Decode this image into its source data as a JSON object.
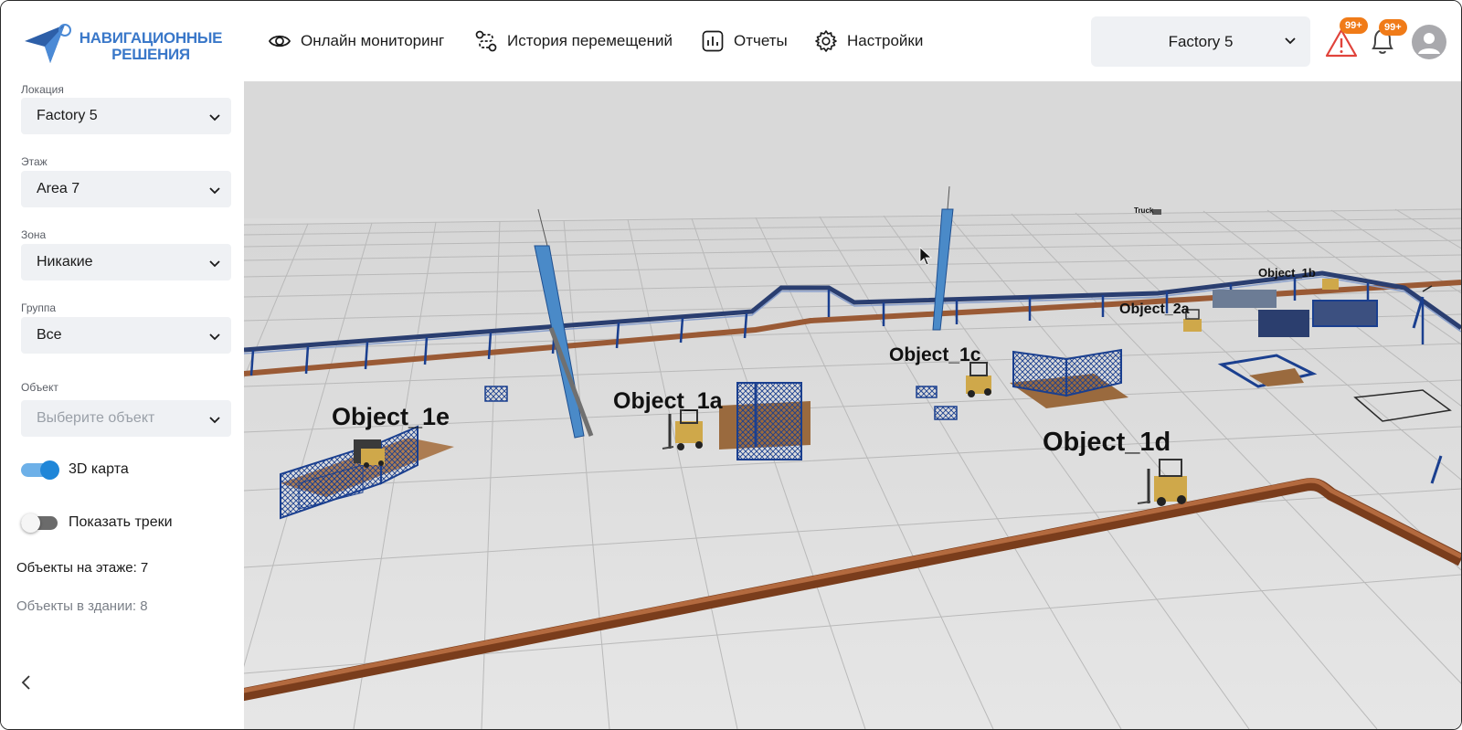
{
  "logo": {
    "line1": "НАВИГАЦИОННЫЕ",
    "line2": "РЕШЕНИЯ"
  },
  "nav": {
    "monitoring": "Онлайн мониторинг",
    "history": "История перемещений",
    "reports": "Отчеты",
    "settings": "Настройки"
  },
  "header": {
    "location_value": "Factory 5",
    "alerts_badge": "99+",
    "notifications_badge": "99+"
  },
  "sidebar": {
    "location": {
      "label": "Локация",
      "value": "Factory 5"
    },
    "floor": {
      "label": "Этаж",
      "value": "Area 7"
    },
    "zone": {
      "label": "Зона",
      "value": "Никакие"
    },
    "group": {
      "label": "Группа",
      "value": "Все"
    },
    "object": {
      "label": "Объект",
      "placeholder": "Выберите объект"
    },
    "map3d": {
      "label": "3D карта",
      "on": true
    },
    "tracks": {
      "label": "Показать треки",
      "on": false
    },
    "floor_objects": {
      "label": "Объекты на этаже:",
      "value": "7"
    },
    "building_objects": {
      "label": "Объекты в здании:",
      "value": "8"
    }
  },
  "map": {
    "objects": [
      {
        "name": "Object_1e"
      },
      {
        "name": "Object_1a"
      },
      {
        "name": "Object_1c"
      },
      {
        "name": "Object_1d"
      },
      {
        "name": "Object_2a"
      },
      {
        "name": "Object_1b"
      },
      {
        "name": "Truck"
      }
    ]
  },
  "colors": {
    "brand": "#3a78c9",
    "badge": "#f07b18",
    "toggle_on": "#1f86d8",
    "rack_blue": "#1a3f8f",
    "belt_brown": "#9a5a35"
  },
  "icons": {
    "monitoring": "eye-icon",
    "history": "route-icon",
    "reports": "chart-icon",
    "settings": "gear-icon",
    "alert": "warning-icon",
    "notifications": "bell-icon",
    "user": "user-icon"
  }
}
